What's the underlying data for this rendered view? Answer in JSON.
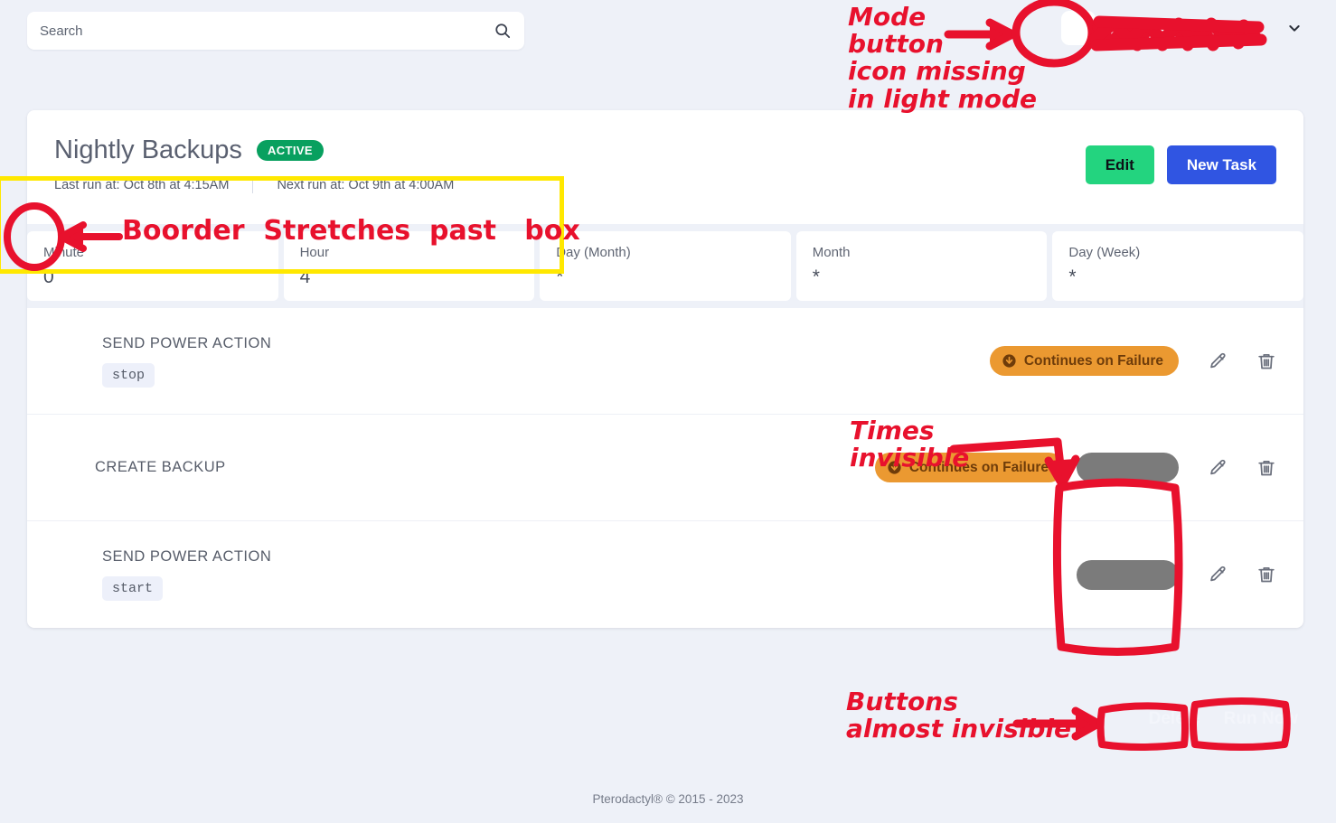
{
  "search": {
    "placeholder": "Search",
    "value": "",
    "icon": "search-icon"
  },
  "header": {
    "mode_button": {
      "icon": "moon-icon",
      "label": ""
    },
    "username_redacted": "",
    "chevron": "chevron-down-icon"
  },
  "schedule": {
    "title": "Nightly Backups",
    "status": "ACTIVE",
    "status_color": "#08a05f",
    "last_run": "Last run at: Oct 8th at 4:15AM",
    "next_run": "Next run at: Oct 9th at 4:00AM",
    "edit_label": "Edit",
    "edit_color": "#23d47f",
    "new_task_label": "New Task",
    "new_task_color": "#3055e2"
  },
  "cron": [
    {
      "label": "Minute",
      "value": "0"
    },
    {
      "label": "Hour",
      "value": "4"
    },
    {
      "label": "Day (Month)",
      "value": "*"
    },
    {
      "label": "Month",
      "value": "*"
    },
    {
      "label": "Day (Week)",
      "value": "*"
    }
  ],
  "tasks": [
    {
      "action": "SEND POWER ACTION",
      "payload": "stop",
      "has_payload": true,
      "badge": "Continues on Failure",
      "badge_color": "#eb9931",
      "badge_icon": "arrow-down-circle-icon",
      "time_redacted": false,
      "edit_icon": "pencil-icon",
      "delete_icon": "trash-icon"
    },
    {
      "action": "CREATE BACKUP",
      "payload": "",
      "has_payload": false,
      "badge": "Continues on Failure",
      "badge_color": "#eb9931",
      "badge_icon": "arrow-down-circle-icon",
      "time_redacted": true,
      "edit_icon": "pencil-icon",
      "delete_icon": "trash-icon"
    },
    {
      "action": "SEND POWER ACTION",
      "payload": "start",
      "has_payload": true,
      "badge": "",
      "badge_color": "#eb9931",
      "badge_icon": "arrow-down-circle-icon",
      "time_redacted": true,
      "edit_icon": "pencil-icon",
      "delete_icon": "trash-icon"
    }
  ],
  "bottom": {
    "delete_label": "Delete",
    "run_now_label": "Run Now"
  },
  "footer": {
    "text": "Pterodactyl® © 2015 - 2023"
  },
  "annotations": {
    "ink_color": "#e8112d",
    "highlight_color": "#ffe800",
    "mode_button": "Mode\nbutton\nicon missing\nin light mode",
    "border": "Boorder  Stretches  past   box",
    "times": "Times\ninvisible",
    "buttons": "Buttons\nalmost invisible"
  }
}
